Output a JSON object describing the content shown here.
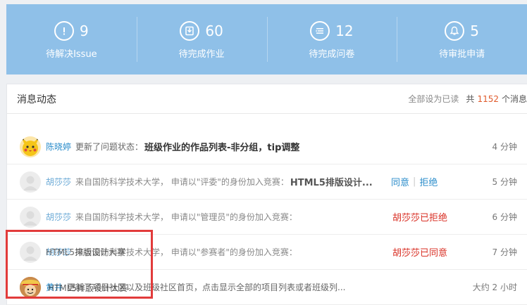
{
  "stats": [
    {
      "icon": "exclamation-circle-icon",
      "count": "9",
      "label": "待解决Issue"
    },
    {
      "icon": "homework-icon",
      "count": "60",
      "label": "待完成作业"
    },
    {
      "icon": "list-icon",
      "count": "12",
      "label": "待完成问卷"
    },
    {
      "icon": "bell-icon",
      "count": "5",
      "label": "待审批申请"
    }
  ],
  "panel": {
    "title": "消息动态",
    "mark_all_read": "全部设为已读",
    "total_prefix": "共",
    "total_count": "1152",
    "total_suffix": "个消息"
  },
  "messages": [
    {
      "user": "陈晓婷",
      "desc": "更新了问题状态：",
      "title": "班级作业的作品列表-非分组，tip调整",
      "time": "4 分钟"
    },
    {
      "user": "胡莎莎",
      "desc": "来自国防科学技术大学， 申请以\"评委\"的身份加入竞赛：",
      "title": "HTML5排版设计...",
      "accept": "同意",
      "reject": "拒绝",
      "time": "5 分钟"
    },
    {
      "user": "胡莎莎",
      "desc": "来自国防科学技术大学， 申请以\"管理员\"的身份加入竞赛：",
      "status": "胡莎莎已拒绝",
      "time": "6 分钟"
    },
    {
      "user": "胡莎莎",
      "desc": "来自国防科学技术大学， 申请以\"参赛者\"的身份加入竞赛：",
      "status": "胡莎莎已同意",
      "time": "7 分钟"
    },
    {
      "user": "黄井",
      "desc": "更新了项目社区以及班级社区首页，点击显示全部的项目列表或者班级列...",
      "time": "大约 2 小时"
    }
  ],
  "ghost": {
    "row4": "HTML5排版设计大赛",
    "row5": "HTML5排版设计大赛"
  },
  "colors": {
    "stats_bg": "#8fc0e8",
    "link": "#2d8ecb",
    "alert": "#d93025",
    "count": "#e05a2b",
    "highlight": "#e23b3b"
  }
}
